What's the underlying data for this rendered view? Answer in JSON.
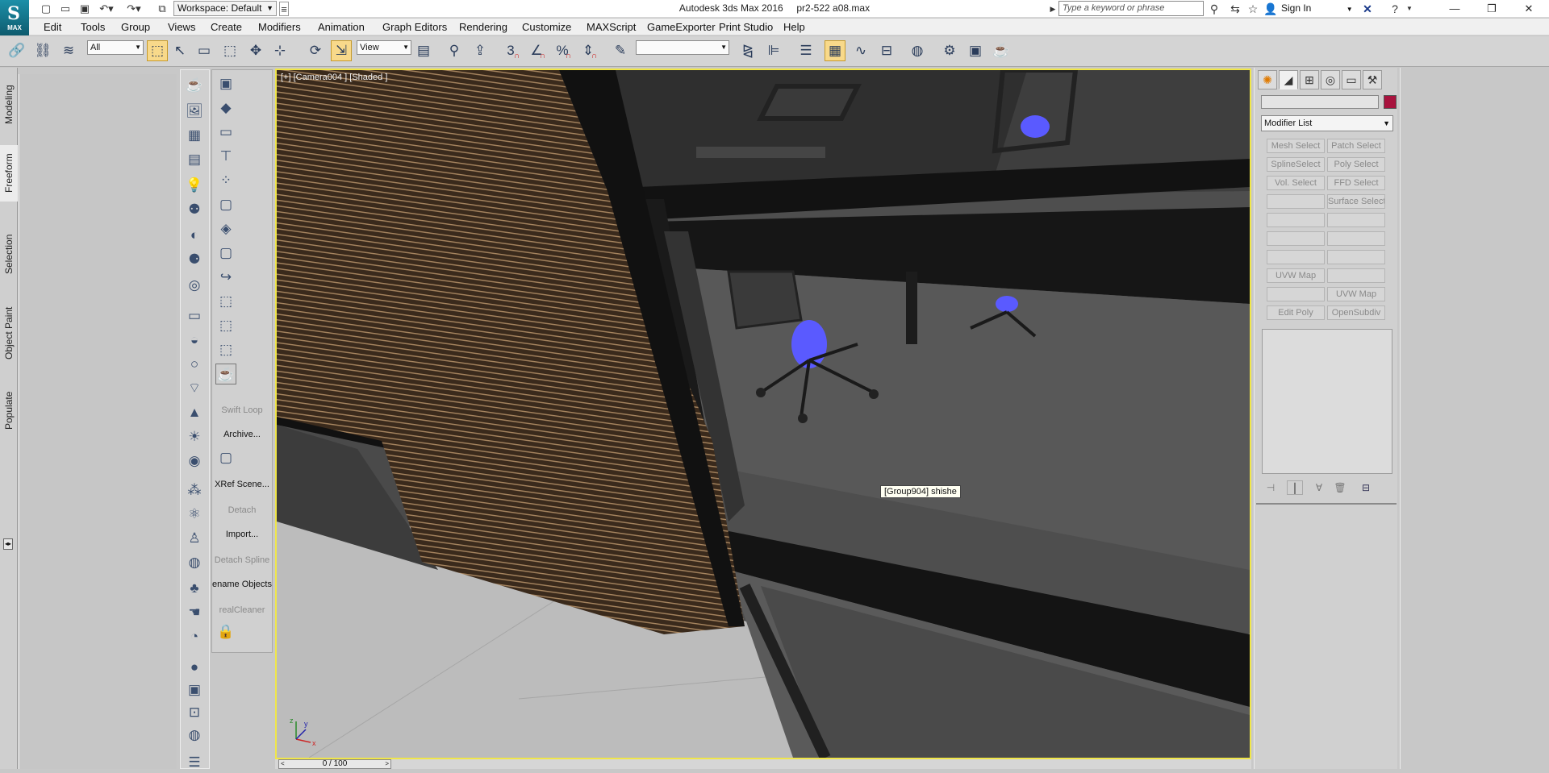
{
  "window": {
    "app_title": "Autodesk 3ds Max 2016",
    "file_name": "pr2-522 a08.max",
    "logo_text": "MAX",
    "workspace": "Workspace: Default",
    "help_search_placeholder": "Type a keyword or phrase",
    "sign_in": "Sign In"
  },
  "menus": [
    "Edit",
    "Tools",
    "Group",
    "Views",
    "Create",
    "Modifiers",
    "Animation",
    "Graph Editors",
    "Rendering",
    "Customize",
    "MAXScript",
    "GameExporter",
    "Print Studio",
    "Help"
  ],
  "toolbar": {
    "selection_filter": "All",
    "reference_coord": "View",
    "snap_angle_label": "3",
    "named_selection": ""
  },
  "ribbon_tabs": [
    "Modeling",
    "Freeform",
    "Selection",
    "Object Paint",
    "Populate"
  ],
  "ribbon_active": "Freeform",
  "command_labels": {
    "swift_loop": "Swift Loop",
    "archive": "Archive...",
    "xref_scene": "XRef Scene...",
    "detach": "Detach",
    "import": "Import...",
    "detach_spline": "Detach Spline",
    "rename_objects": "ename Objects",
    "real_cleaner": "realCleaner"
  },
  "viewport": {
    "label": "[+] [Camera004 ] [Shaded ]",
    "tooltip": "[Group904] shishe",
    "axis_x": "x",
    "axis_y": "y",
    "axis_z": "z"
  },
  "timeline": {
    "frame": "0 / 100"
  },
  "command_panel": {
    "modifier_list": "Modifier List",
    "object_color": "#a8133e",
    "buttons": [
      [
        "Mesh Select",
        "Patch Select"
      ],
      [
        "SplineSelect",
        "Poly Select"
      ],
      [
        "Vol. Select",
        "FFD Select"
      ],
      [
        "",
        "Surface Select"
      ],
      [
        "",
        ""
      ],
      [
        "",
        ""
      ],
      [
        "",
        ""
      ],
      [
        "UVW Map",
        ""
      ],
      [
        "",
        "UVW Map"
      ],
      [
        "Edit Poly",
        "OpenSubdiv"
      ]
    ]
  },
  "colors": {
    "viewport_border": "#f0e64a",
    "selected_highlight": "#5a5aff"
  }
}
